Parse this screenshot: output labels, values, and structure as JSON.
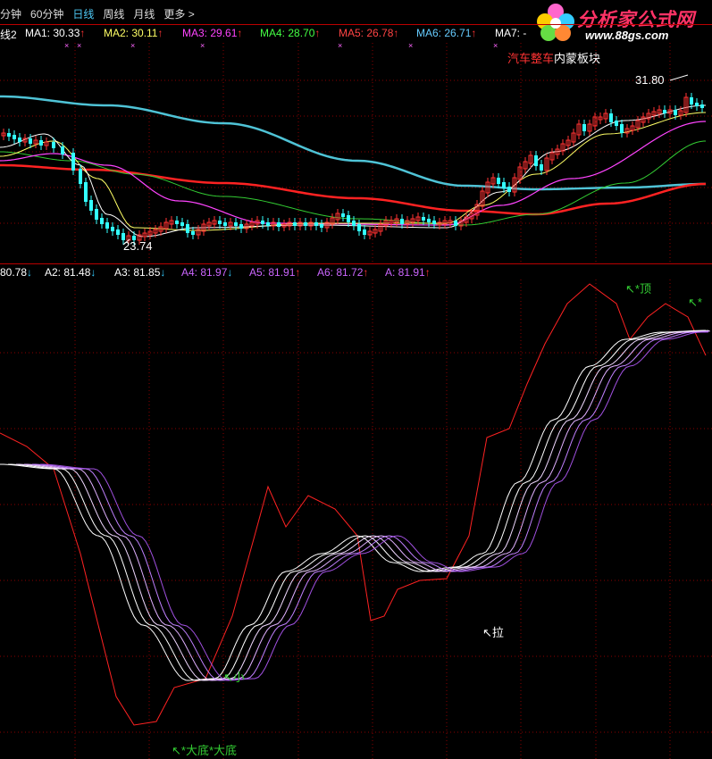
{
  "toolbar": {
    "tabs": [
      {
        "label": "分钟"
      },
      {
        "label": "60分钟"
      },
      {
        "label": "日线"
      },
      {
        "label": "周线"
      },
      {
        "label": "月线"
      },
      {
        "label": "更多 >"
      }
    ]
  },
  "logo": {
    "brand": "分析家公式网",
    "url": "www.88gs.com"
  },
  "ma_legend": {
    "prefix": "线2",
    "items": [
      {
        "label": "MA1: 30.33",
        "arrow": "↑",
        "color": "#ffffff"
      },
      {
        "label": "MA2: 30.11",
        "arrow": "↑",
        "color": "#ffff66"
      },
      {
        "label": "MA3: 29.61",
        "arrow": "↑",
        "color": "#ff44ff"
      },
      {
        "label": "MA4: 28.70",
        "arrow": "↑",
        "color": "#44ff44"
      },
      {
        "label": "MA5: 26.78",
        "arrow": "↑",
        "color": "#ff4444"
      },
      {
        "label": "MA6: 26.71",
        "arrow": "↑",
        "color": "#66ccff"
      },
      {
        "label": "MA7: -",
        "arrow": "",
        "color": "#ffffff"
      }
    ]
  },
  "board": {
    "name": "汽车整车",
    "section": "内蒙板块",
    "name_color": "#ff3333",
    "section_color": "#ffffff"
  },
  "price_labels": {
    "high": "31.80",
    "low": "23.74"
  },
  "indicator_legend": [
    {
      "label": "80.78",
      "arrow": "↓",
      "color": "#ffffff"
    },
    {
      "label": "A2: 81.48",
      "arrow": "↓",
      "color": "#ffffff"
    },
    {
      "label": "A3: 81.85",
      "arrow": "↓",
      "color": "#ffffff"
    },
    {
      "label": "A4: 81.97",
      "arrow": "↓",
      "color": "#cc66ff"
    },
    {
      "label": "A5: 81.91",
      "arrow": "↑",
      "color": "#cc66ff"
    },
    {
      "label": "A6: 81.72",
      "arrow": "↑",
      "color": "#cc66ff"
    },
    {
      "label": "A: 81.91",
      "arrow": "↑",
      "color": "#cc66ff"
    }
  ],
  "signals": {
    "top": "↖*顶",
    "top2": "↖*",
    "pull": "↖拉",
    "small": "↖小",
    "bottom": "↖*大底*大底"
  },
  "colors": {
    "up_candle": "#ff3333",
    "down_candle": "#33ffff",
    "grid": "#8b0000",
    "separator": "#b00000",
    "signal_green": "#33cc33",
    "signal_white": "#ffffff"
  }
}
